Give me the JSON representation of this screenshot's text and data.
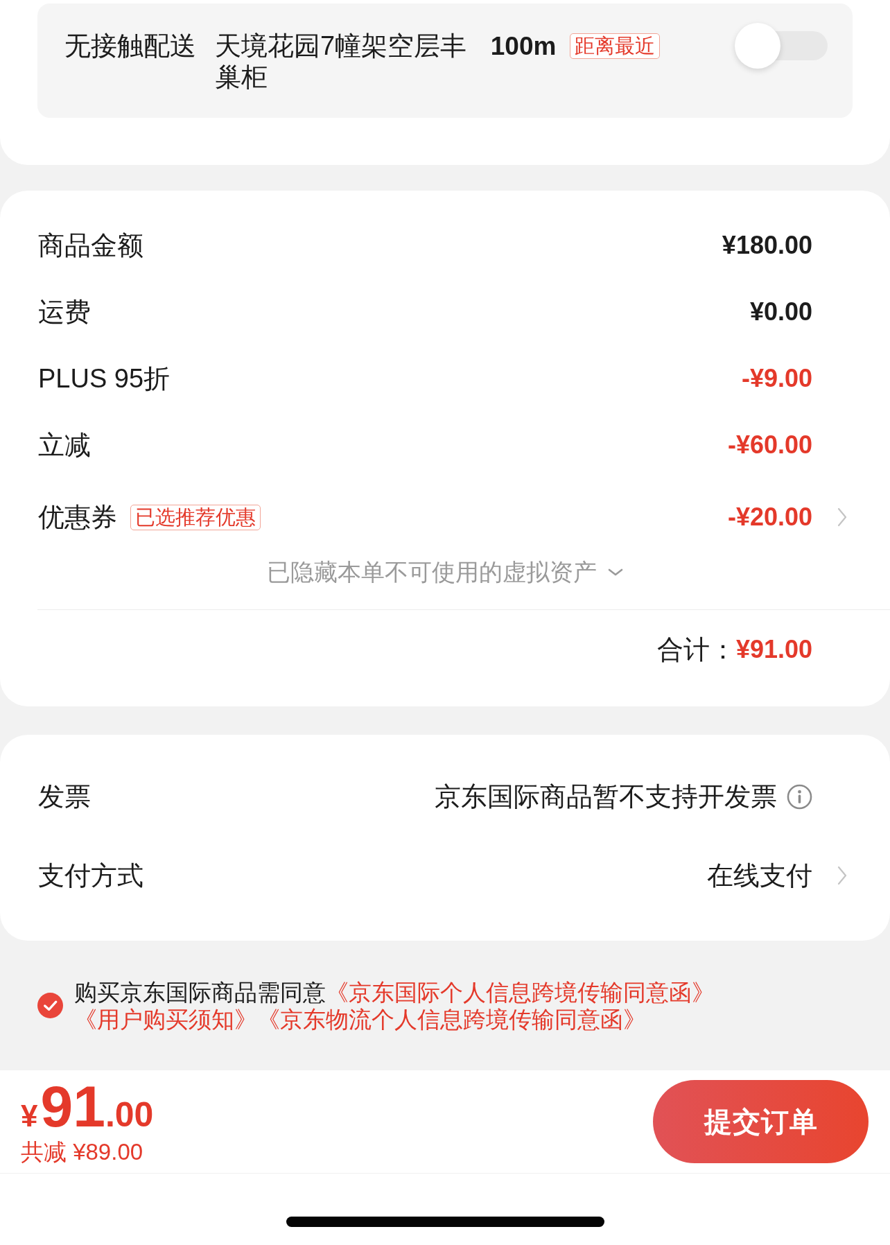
{
  "delivery": {
    "label": "无接触配送",
    "address": "天境花园7幢架空层丰巢柜",
    "distance": "100m",
    "badge": "距离最近",
    "on": false
  },
  "summary": {
    "rows": [
      {
        "label": "商品金额",
        "value": "¥180.00",
        "kind": "amount"
      },
      {
        "label": "运费",
        "value": "¥0.00",
        "kind": "amount"
      },
      {
        "label": "PLUS 95折",
        "value": "-¥9.00",
        "kind": "discount"
      },
      {
        "label": "立减",
        "value": "-¥60.00",
        "kind": "discount"
      },
      {
        "label": "优惠券",
        "badge": "已选推荐优惠",
        "value": "-¥20.00",
        "kind": "coupon"
      }
    ],
    "hidden_assets": {
      "text": "已隐藏本单不可使用的虚拟资产",
      "expanded": false
    },
    "total_label": "合计：",
    "total_value": "¥91.00"
  },
  "details": [
    {
      "label": "发票",
      "value": "京东国际商品暂不支持开发票",
      "kind": "info"
    },
    {
      "label": "支付方式",
      "value": "在线支付",
      "kind": "link"
    }
  ],
  "agreement": {
    "checked": true,
    "text": "购买京东国际商品需同意",
    "links": [
      "《京东国际个人信息跨境传输同意函》",
      "《用户购买须知》",
      "《京东物流个人信息跨境传输同意函》"
    ]
  },
  "footer": {
    "currency": "¥",
    "amount_integer": "91",
    "amount_decimal": ".00",
    "savings": "共减 ¥89.00",
    "submit": "提交订单"
  }
}
